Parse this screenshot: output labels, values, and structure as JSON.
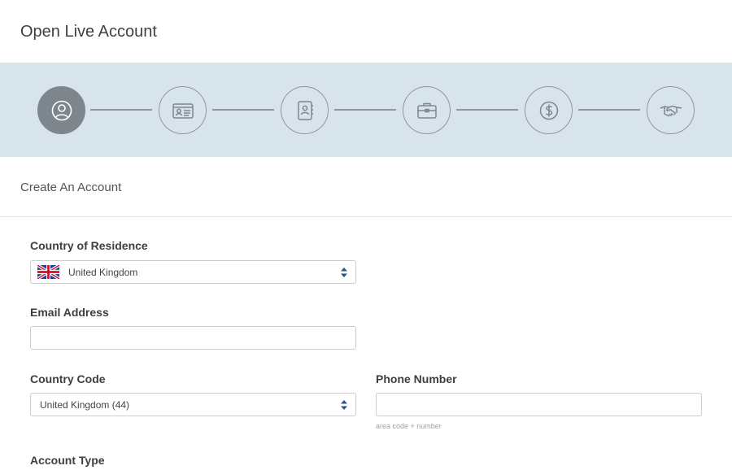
{
  "page": {
    "title": "Open Live Account",
    "section_title": "Create An Account"
  },
  "steps": [
    {
      "icon": "user-circle-icon",
      "active": true
    },
    {
      "icon": "id-card-icon",
      "active": false
    },
    {
      "icon": "address-book-icon",
      "active": false
    },
    {
      "icon": "briefcase-icon",
      "active": false
    },
    {
      "icon": "dollar-coin-icon",
      "active": false
    },
    {
      "icon": "handshake-icon",
      "active": false
    }
  ],
  "form": {
    "country_of_residence": {
      "label": "Country of Residence",
      "value": "United Kingdom",
      "flag_icon": "uk-flag-icon"
    },
    "email": {
      "label": "Email Address",
      "value": ""
    },
    "country_code": {
      "label": "Country Code",
      "value": "United Kingdom (44)"
    },
    "phone": {
      "label": "Phone Number",
      "value": "",
      "hint": "area code + number"
    },
    "account_type": {
      "label": "Account Type"
    }
  },
  "colors": {
    "stepper_bg": "#d7e4ec",
    "step_active": "#7d868d",
    "step_outline": "#8e979e",
    "select_arrow": "#2d4f8c"
  }
}
